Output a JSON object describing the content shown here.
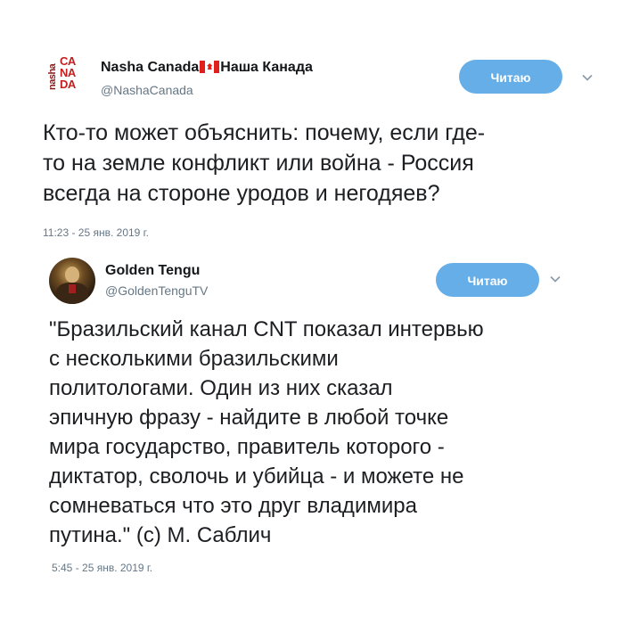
{
  "tweets": [
    {
      "avatar": {
        "line1": "CA",
        "line2": "NA",
        "line3": "DA",
        "side": "nasha"
      },
      "display_name_part1": "Nasha Canada",
      "flag": "canada-flag",
      "display_name_part2": "Наша Канада",
      "handle": "@NashaCanada",
      "follow_label": "Читаю",
      "text_lines": [
        "Кто-то может объяснить: почему, если где-",
        "то на земле конфликт или война - Россия",
        "всегда на стороне уродов и негодяев?"
      ],
      "timestamp": "11:23 - 25 янв. 2019 г."
    },
    {
      "display_name": "Golden Tengu",
      "handle": "@GoldenTenguTV",
      "follow_label": "Читаю",
      "text_lines": [
        "\"Бразильский канал CNT показал  интервью",
        "с несколькими бразильскими",
        "политологами. Один из них сказал",
        "эпичную фразу - найдите в любой точке",
        "мира государство, правитель  которого -",
        "диктатор, сволочь и убийца - и можете не",
        "сомневаться что это  друг владимира",
        "путина.\" (с) М. Саблич"
      ],
      "timestamp": "5:45 - 25 янв. 2019 г."
    }
  ],
  "colors": {
    "follow_bg": "#66aee8",
    "muted": "#657786",
    "brand_red": "#c41e1e"
  }
}
